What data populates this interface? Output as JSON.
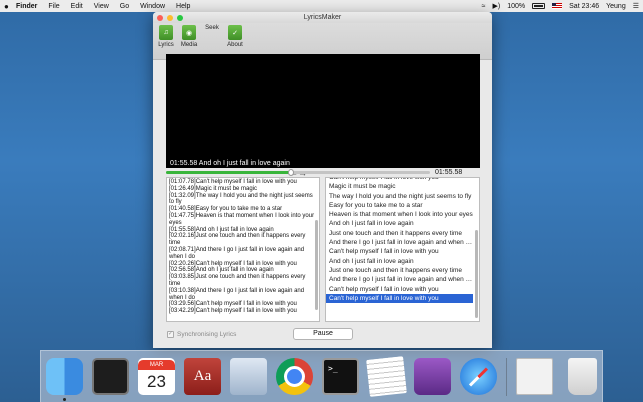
{
  "menubar": {
    "apple": "",
    "items": [
      "Finder",
      "File",
      "Edit",
      "View",
      "Go",
      "Window",
      "Help"
    ],
    "battery": "100%",
    "clock": "Sat 23:46",
    "user": "Yeung"
  },
  "window": {
    "title": "LyricsMaker",
    "toolbar": [
      {
        "label": "Lyrics",
        "icon": "lyrics-doc-icon"
      },
      {
        "label": "Media",
        "icon": "media-icon"
      },
      {
        "label": "Seek",
        "icon": "seek-icon"
      },
      {
        "label": "About",
        "icon": "about-icon"
      }
    ],
    "video": {
      "caption": "01:55.58 And oh I just fall in love again"
    },
    "seek": {
      "time": "01:55.58",
      "progress": 0.475
    },
    "lyrics_text": [
      "[01:07.78]Can't help myself I fall in love with you",
      "[01:26.49]Magic it must be magic",
      "[01:32.09]The way I hold you and the night just seems to fly",
      "[01:40.58]Easy for you to take me to a star",
      "[01:47.75]Heaven is that moment when I look into your eyes",
      "[01:55.58]And oh I just fall in love again",
      "[02:02.16]Just one touch and then it happens every time",
      "[02:08.71]And there I go I just fall in love again and when I do",
      "[02:20.26]Can't help myself I fall in love with you",
      "[02:56.58]And oh I just fall in love again",
      "[03:03.85]Just one touch and then it happens every time",
      "[03:10.38]And there I go I just fall in love again and when I do",
      "[03:29.56]Can't help myself I fall in love with you",
      "[03:42.29]Can't help myself I fall in love with you"
    ],
    "lyric_list": [
      "Can't help myself I fall in love with you",
      "Magic it must be magic",
      "The way I hold you and the night just seems to fly",
      "Easy for you to take me to a star",
      "Heaven is that moment when I look into your eyes",
      "And oh I just fall in love again",
      "Just one touch and then it happens every time",
      "And there I go I just fall in love again and when I do",
      "Can't help myself I fall in love with you",
      "And oh I just fall in love again",
      "Just one touch and then it happens every time",
      "And there I go I just fall in love again and when I do",
      "Can't help myself I fall in love with you",
      "Can't help myself I fall in love with you"
    ],
    "selected_index": 13,
    "sync_label": "Synchronising Lyrics",
    "sync_checked": true,
    "pause_label": "Pause"
  },
  "dock": {
    "calendar_month": "MAR",
    "calendar_day": "23",
    "dictionary_glyph": "Aa",
    "terminal_prompt": ">_",
    "apps": [
      "finder-icon",
      "activity-monitor-icon",
      "calendar-icon",
      "dictionary-icon",
      "preview-icon",
      "chrome-icon",
      "terminal-icon",
      "textedit-icon",
      "xcode-icon",
      "safari-icon",
      "screenshot-doc-icon",
      "trash-icon"
    ]
  }
}
